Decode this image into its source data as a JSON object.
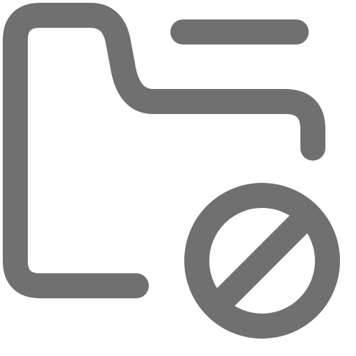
{
  "icon": {
    "name": "folder-blocked-icon",
    "color": "#707070",
    "background": "#ffffff"
  }
}
